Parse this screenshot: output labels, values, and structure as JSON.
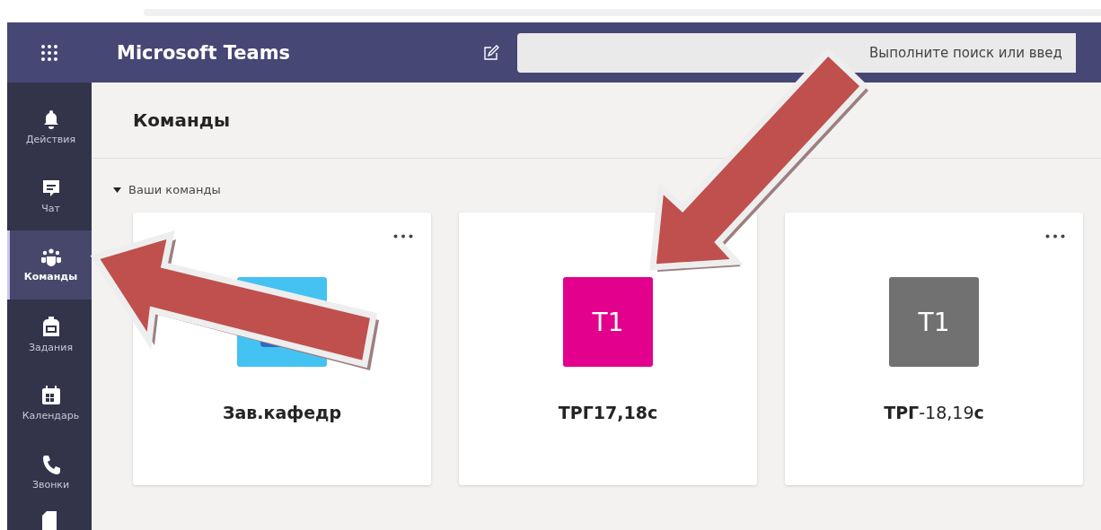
{
  "header": {
    "title": "Microsoft Teams",
    "search": {
      "placeholder": "Выполните поиск или введ"
    }
  },
  "rail": [
    {
      "label": "Действия",
      "kind": "bell",
      "selected": false
    },
    {
      "label": "Чат",
      "kind": "chat",
      "selected": false
    },
    {
      "label": "Команды",
      "kind": "teams",
      "selected": true
    },
    {
      "label": "Задания",
      "kind": "backpack",
      "selected": false
    },
    {
      "label": "Календарь",
      "kind": "calendar",
      "selected": false
    },
    {
      "label": "Звонки",
      "kind": "phone",
      "selected": false
    }
  ],
  "page": {
    "title": "Команды",
    "section": {
      "label": "Ваши команды",
      "expanded": true
    }
  },
  "teams": [
    {
      "name": "Зав.кафедр",
      "more_options": true
    },
    {
      "name": "ТРГ17,18с",
      "more_options": false,
      "avatar": {
        "kind": "initials",
        "text": "Т1",
        "color": "#e3008c"
      }
    },
    {
      "name": "**ТРГ**-18,19**с**",
      "more_options": true,
      "avatar": {
        "kind": "initials",
        "text": "Т1",
        "color": "#717171"
      }
    }
  ]
}
